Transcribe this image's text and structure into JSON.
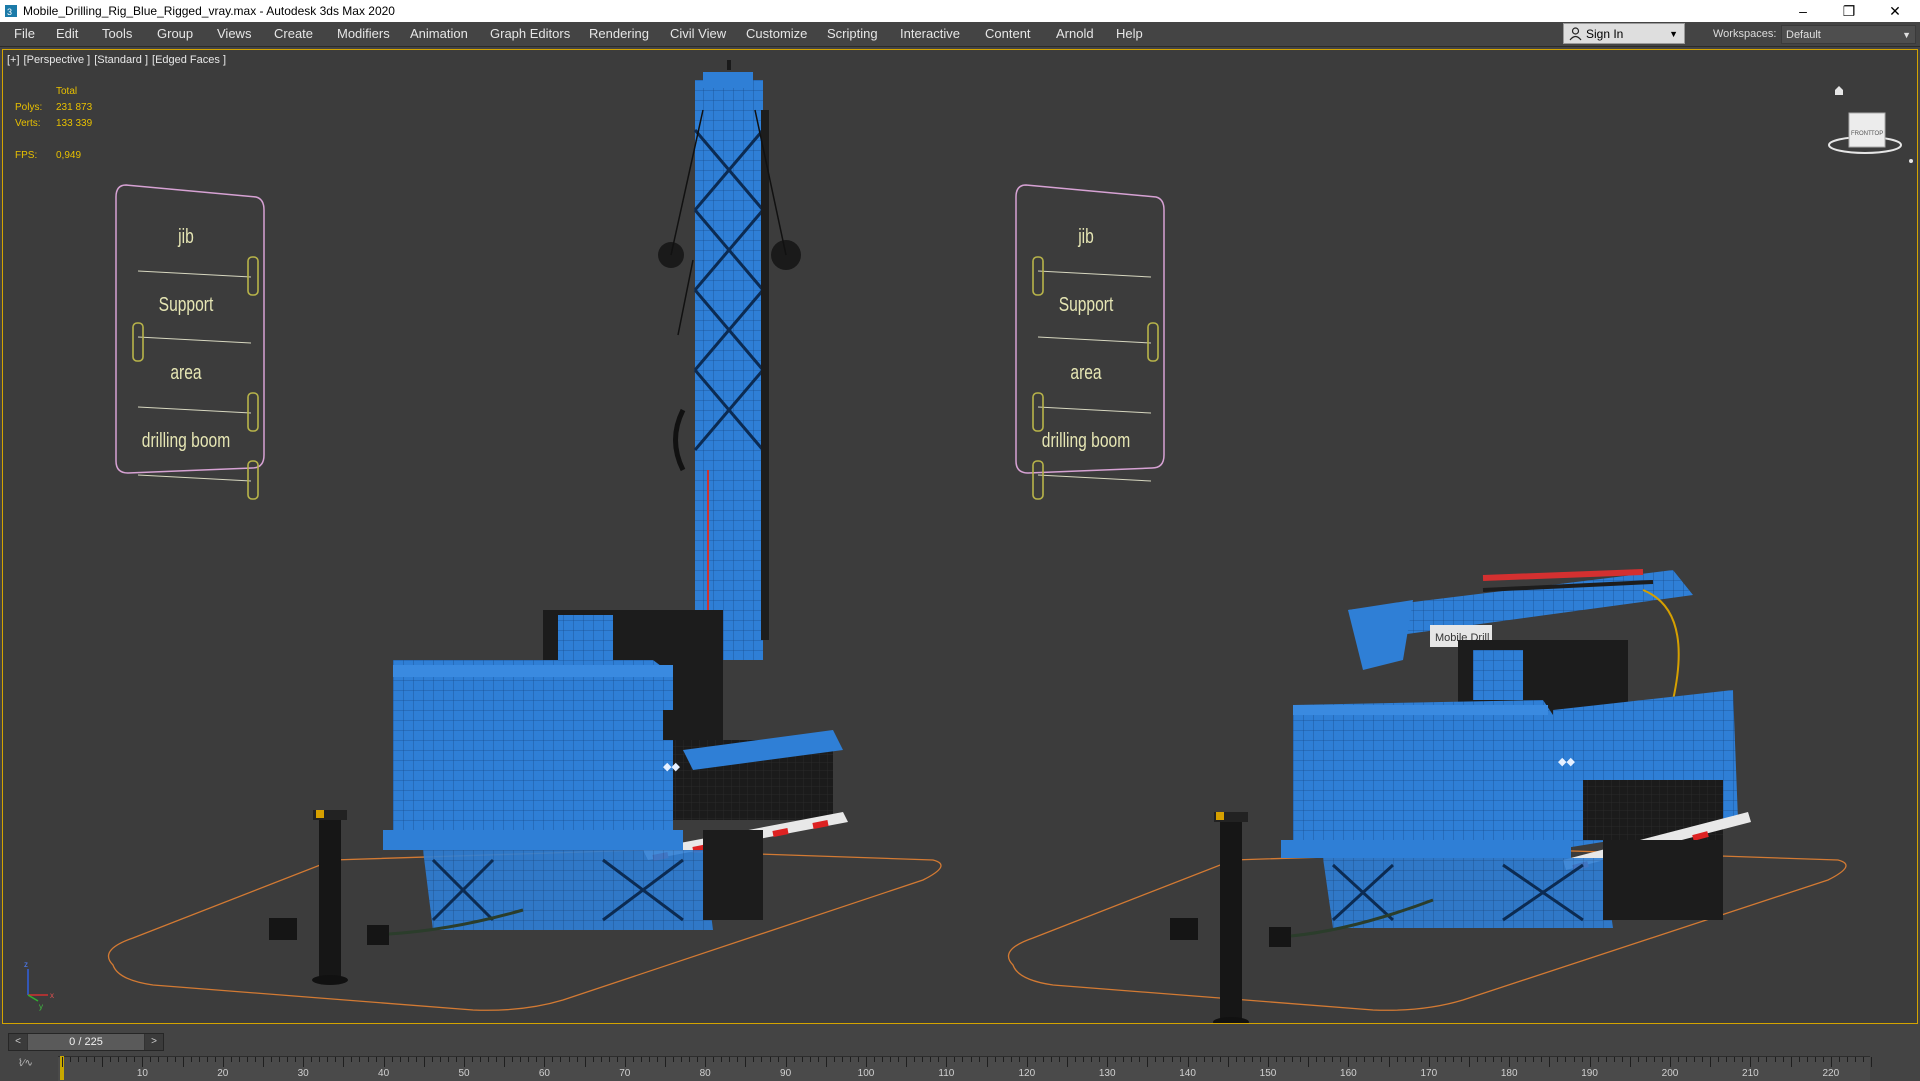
{
  "window": {
    "title": "Mobile_Drilling_Rig_Blue_Rigged_vray.max - Autodesk 3ds Max 2020",
    "controls": [
      "–",
      "❐",
      "✕"
    ]
  },
  "menu": [
    "File",
    "Edit",
    "Tools",
    "Group",
    "Views",
    "Create",
    "Modifiers",
    "Animation",
    "Graph Editors",
    "Rendering",
    "Civil View",
    "Customize",
    "Scripting",
    "Interactive",
    "Content",
    "Arnold",
    "Help"
  ],
  "account": {
    "sign_in": "Sign In"
  },
  "workspace": {
    "label": "Workspaces:",
    "value": "Default"
  },
  "viewport": {
    "label_parts": [
      "[+]",
      "[Perspective ]",
      "[Standard ]",
      "[Edged Faces ]"
    ],
    "stats": {
      "total_label": "Total",
      "polys_label": "Polys:",
      "polys_value": "231 873",
      "verts_label": "Verts:",
      "verts_value": "133 339",
      "fps_label": "FPS:",
      "fps_value": "0,949"
    },
    "viewcube_labels": [
      "FRONT",
      "TOP"
    ],
    "axis_labels": [
      "x",
      "y",
      "z"
    ],
    "truck_logo_text": "Mobile Drill"
  },
  "rig_panels": [
    {
      "sliders": [
        {
          "label": "jib",
          "value": 1.0
        },
        {
          "label": "Support",
          "value": 0.0
        },
        {
          "label": "area",
          "value": 1.0
        },
        {
          "label": "drilling boom",
          "value": 1.0
        }
      ]
    },
    {
      "sliders": [
        {
          "label": "jib",
          "value": 0.0
        },
        {
          "label": "Support",
          "value": 1.0
        },
        {
          "label": "area",
          "value": 0.0
        },
        {
          "label": "drilling boom",
          "value": 0.0
        }
      ]
    }
  ],
  "timeline": {
    "frame_display": "0 / 225",
    "prev": "<",
    "next": ">",
    "current_frame": 0,
    "tick_labels": [
      "10",
      "20",
      "30",
      "40",
      "50",
      "60",
      "70",
      "80",
      "90",
      "100",
      "110",
      "120",
      "130",
      "140",
      "150",
      "160",
      "170",
      "180",
      "190",
      "200",
      "210",
      "220"
    ]
  },
  "colors": {
    "accent": "#d4a400",
    "viewport_bg": "#3c3c3c",
    "rig_blue": "#2f7fd6",
    "panel_outline": "#d7a2d4",
    "slider_olive": "#b8b44a",
    "ground_outline": "#d37a33"
  }
}
